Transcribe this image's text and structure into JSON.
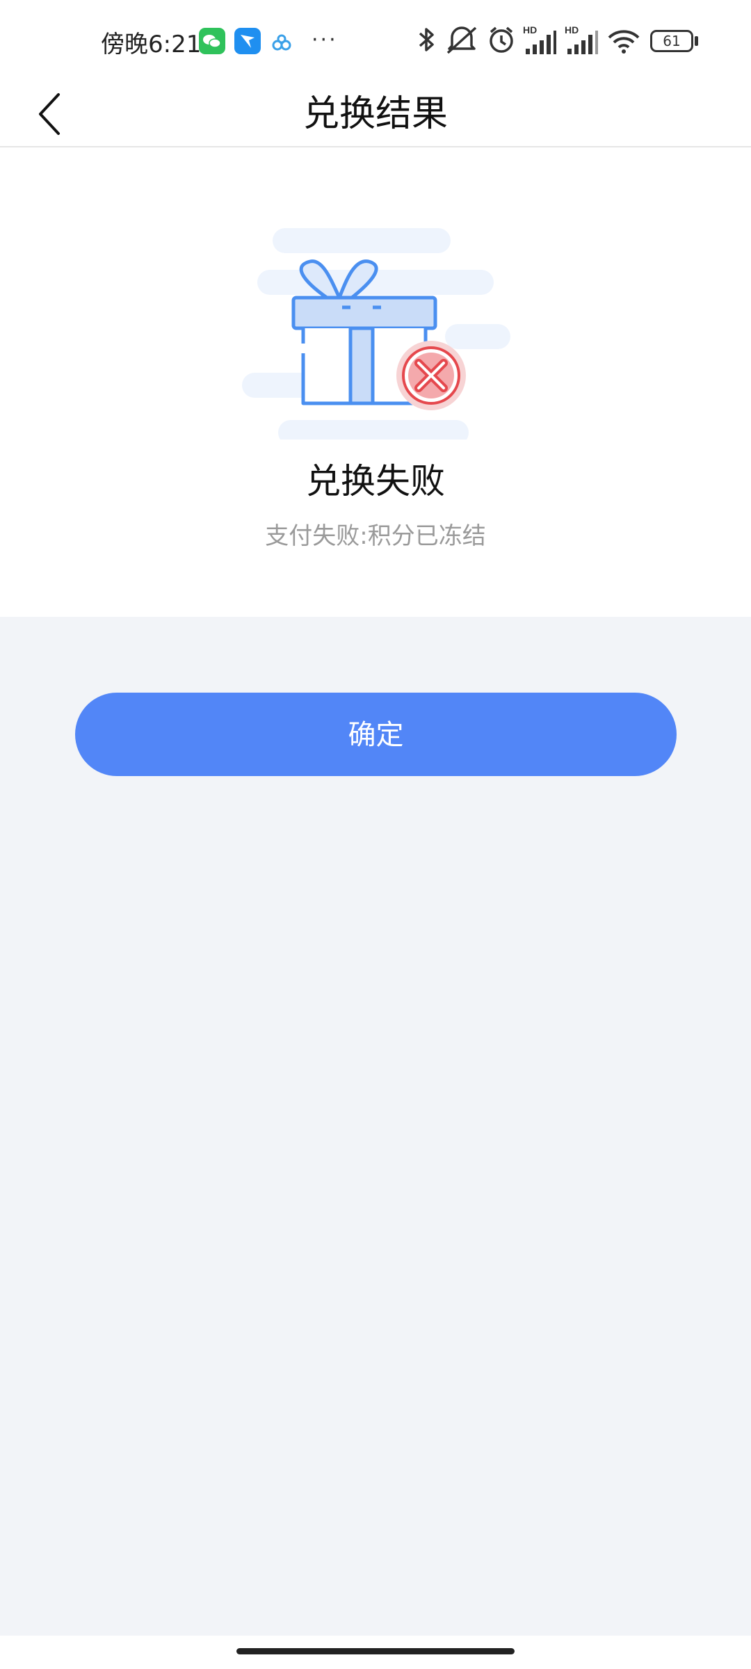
{
  "status_bar": {
    "time": "傍晚6:21",
    "more": "···",
    "battery": "61",
    "icons": [
      "wechat-icon",
      "tencent-icon",
      "cloud-icon",
      "bluetooth-icon",
      "mute-icon",
      "alarm-icon",
      "signal-hd-icon",
      "signal-hd-icon",
      "wifi-icon",
      "battery-icon"
    ],
    "hd_label": "HD"
  },
  "nav": {
    "title": "兑换结果",
    "back_icon": "chevron-left-icon"
  },
  "result": {
    "icon": "gift-failed-icon",
    "title": "兑换失败",
    "message": "支付失败:积分已冻结"
  },
  "actions": {
    "confirm_label": "确定"
  },
  "colors": {
    "primary": "#5286f7",
    "page_background": "#f2f4f8",
    "error": "#e5484d",
    "gift_blue": "#4a8ff0"
  }
}
